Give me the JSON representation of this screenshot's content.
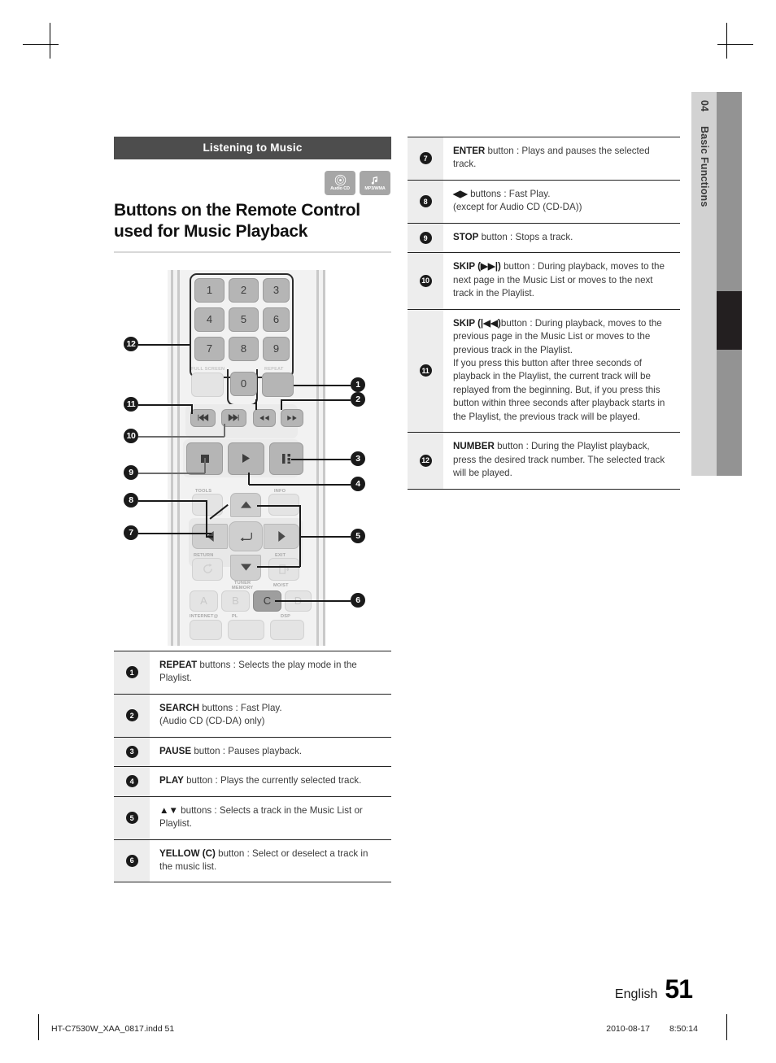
{
  "section": {
    "bar_title": "Listening to Music"
  },
  "badges": [
    {
      "label": "Audio CD",
      "icon": "audio-cd-disc-icon"
    },
    {
      "label": "MP3/WMA",
      "icon": "music-note-icon"
    }
  ],
  "title": "Buttons on the Remote Control used for Music Playback",
  "remote": {
    "keypad": [
      "1",
      "2",
      "3",
      "4",
      "5",
      "6",
      "7",
      "8",
      "9",
      "0"
    ],
    "labels": {
      "full_screen": "FULL SCREEN",
      "repeat": "REPEAT",
      "tools": "TOOLS",
      "info": "INFO",
      "return": "RETURN",
      "exit": "EXIT",
      "tuner": "TUNER",
      "memory": "MEMORY",
      "most": "MO/ST",
      "internet": "INTERNET@",
      "dolby": "PL",
      "dsp": "DSP"
    },
    "color_buttons": [
      "A",
      "B",
      "C",
      "D"
    ],
    "callouts_left": [
      "12",
      "11",
      "10",
      "9",
      "8",
      "7"
    ],
    "callouts_right": [
      "1",
      "2",
      "3",
      "4",
      "5",
      "6"
    ]
  },
  "table_left": [
    {
      "num": "1",
      "bold": "REPEAT",
      "text": " buttons : Selects the play mode in the Playlist."
    },
    {
      "num": "2",
      "bold": "SEARCH",
      "text": " buttons : Fast Play.\n(Audio CD (CD-DA) only)"
    },
    {
      "num": "3",
      "bold": "PAUSE",
      "text": " button : Pauses playback."
    },
    {
      "num": "4",
      "bold": "PLAY",
      "text": " button : Plays the currently selected track."
    },
    {
      "num": "5",
      "bold": "▲▼",
      "text": " buttons : Selects a track in the Music List or Playlist."
    },
    {
      "num": "6",
      "bold": "YELLOW (C)",
      "text": " button : Select or deselect a track in the music list."
    }
  ],
  "table_right": [
    {
      "num": "7",
      "bold": "ENTER",
      "text": " button : Plays and pauses the selected track."
    },
    {
      "num": "8",
      "bold": "◀▶",
      "text": " buttons : Fast Play.\n(except for Audio CD (CD-DA))"
    },
    {
      "num": "9",
      "bold": "STOP",
      "text": " button : Stops a track."
    },
    {
      "num": "10",
      "bold": "SKIP (▶▶|)",
      "text": " button : During playback, moves to the next page in the Music List or moves to the next track in the Playlist."
    },
    {
      "num": "11",
      "bold": "SKIP (|◀◀)",
      "text": "button : During playback, moves to the previous page in the Music List or moves to the previous track in the Playlist.\nIf you press this button after three seconds of playback in the Playlist, the current track will be replayed from the beginning. But, if you press this button within three seconds after playback starts in the Playlist, the previous track will be played."
    },
    {
      "num": "12",
      "bold": "NUMBER",
      "text": " button : During the Playlist playback, press the desired track number. The selected track will be played."
    }
  ],
  "side_tab": {
    "chapter_number": "04",
    "chapter_name": "Basic Functions"
  },
  "footer": {
    "language": "English",
    "page_number": "51",
    "file_name": "HT-C7530W_XAA_0817.indd   51",
    "date": "2010-08-17",
    "time": "8:50:14"
  }
}
